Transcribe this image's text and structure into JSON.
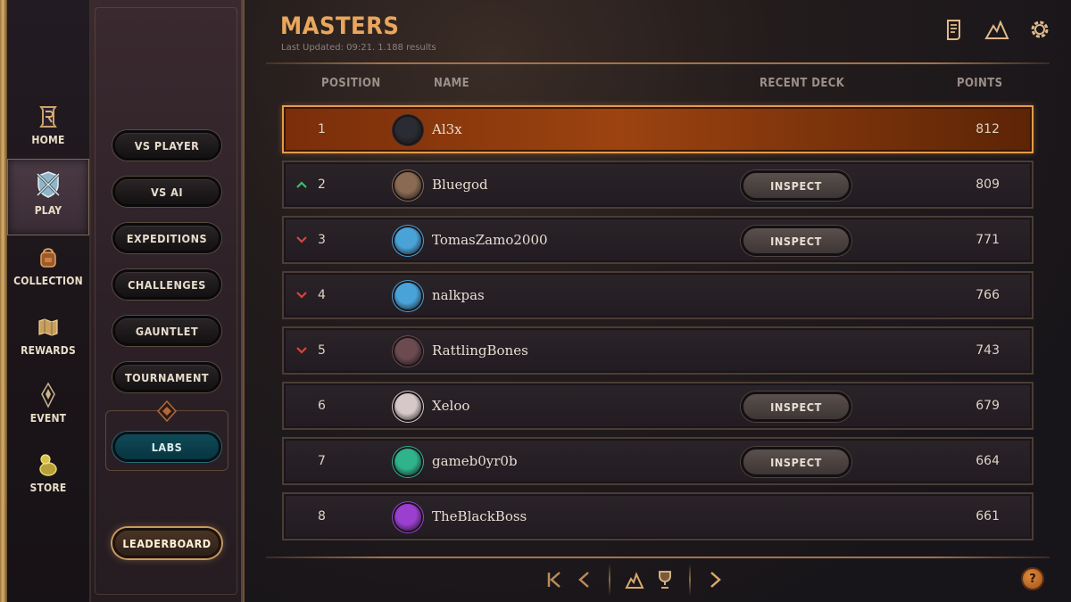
{
  "nav": {
    "items": [
      {
        "label": "HOME",
        "icon": "runeterra-logo-icon"
      },
      {
        "label": "PLAY",
        "icon": "crossed-swords-shield-icon",
        "active": true
      },
      {
        "label": "COLLECTION",
        "icon": "backpack-icon"
      },
      {
        "label": "REWARDS",
        "icon": "scroll-map-icon"
      },
      {
        "label": "EVENT",
        "icon": "event-crest-icon"
      },
      {
        "label": "STORE",
        "icon": "coin-pouch-icon"
      }
    ]
  },
  "play_menu": {
    "vs_player": "VS PLAYER",
    "vs_ai": "VS AI",
    "expeditions": "EXPEDITIONS",
    "challenges": "CHALLENGES",
    "gauntlet": "GAUNTLET",
    "tournament": "TOURNAMENT",
    "labs": "LABS",
    "leaderboard": "LEADERBOARD"
  },
  "leaderboard": {
    "title": "MASTERS",
    "subtitle": "Last Updated: 09:21. 1.188 results",
    "columns": {
      "position": "POSITION",
      "name": "NAME",
      "recent_deck": "RECENT DECK",
      "points": "POINTS"
    },
    "inspect_label": "INSPECT",
    "rows": [
      {
        "position": "1",
        "name": "Al3x",
        "points": "812",
        "trend": "none",
        "inspect": false,
        "avatar_color": "#2b2b33"
      },
      {
        "position": "2",
        "name": "Bluegod",
        "points": "809",
        "trend": "up",
        "inspect": true,
        "avatar_color": "#8a6a52"
      },
      {
        "position": "3",
        "name": "TomasZamo2000",
        "points": "771",
        "trend": "down",
        "inspect": true,
        "avatar_color": "#4aa3d8"
      },
      {
        "position": "4",
        "name": "nalkpas",
        "points": "766",
        "trend": "down",
        "inspect": false,
        "avatar_color": "#4aa3d8"
      },
      {
        "position": "5",
        "name": "RattlingBones",
        "points": "743",
        "trend": "down",
        "inspect": false,
        "avatar_color": "#6b4a50"
      },
      {
        "position": "6",
        "name": "Xeloo",
        "points": "679",
        "trend": "none",
        "inspect": true,
        "avatar_color": "#d6c8c8"
      },
      {
        "position": "7",
        "name": "gameb0yr0b",
        "points": "664",
        "trend": "none",
        "inspect": true,
        "avatar_color": "#2fb38a"
      },
      {
        "position": "8",
        "name": "TheBlackBoss",
        "points": "661",
        "trend": "none",
        "inspect": false,
        "avatar_color": "#9a3fd0"
      }
    ]
  },
  "toolbar_icons": [
    "deck-list-icon",
    "mountain-region-icon",
    "settings-gear-icon"
  ],
  "pager": {
    "icons": [
      "first-page-icon",
      "previous-page-icon",
      "region-filter-icon",
      "trophy-icon",
      "next-page-icon"
    ]
  },
  "help_label": "?",
  "colors": {
    "accent": "#e9a65c",
    "highlight_row": "#9c4310",
    "trend_up": "#3fbf6a",
    "trend_down": "#d9443a",
    "labs": "#0f4a57"
  }
}
